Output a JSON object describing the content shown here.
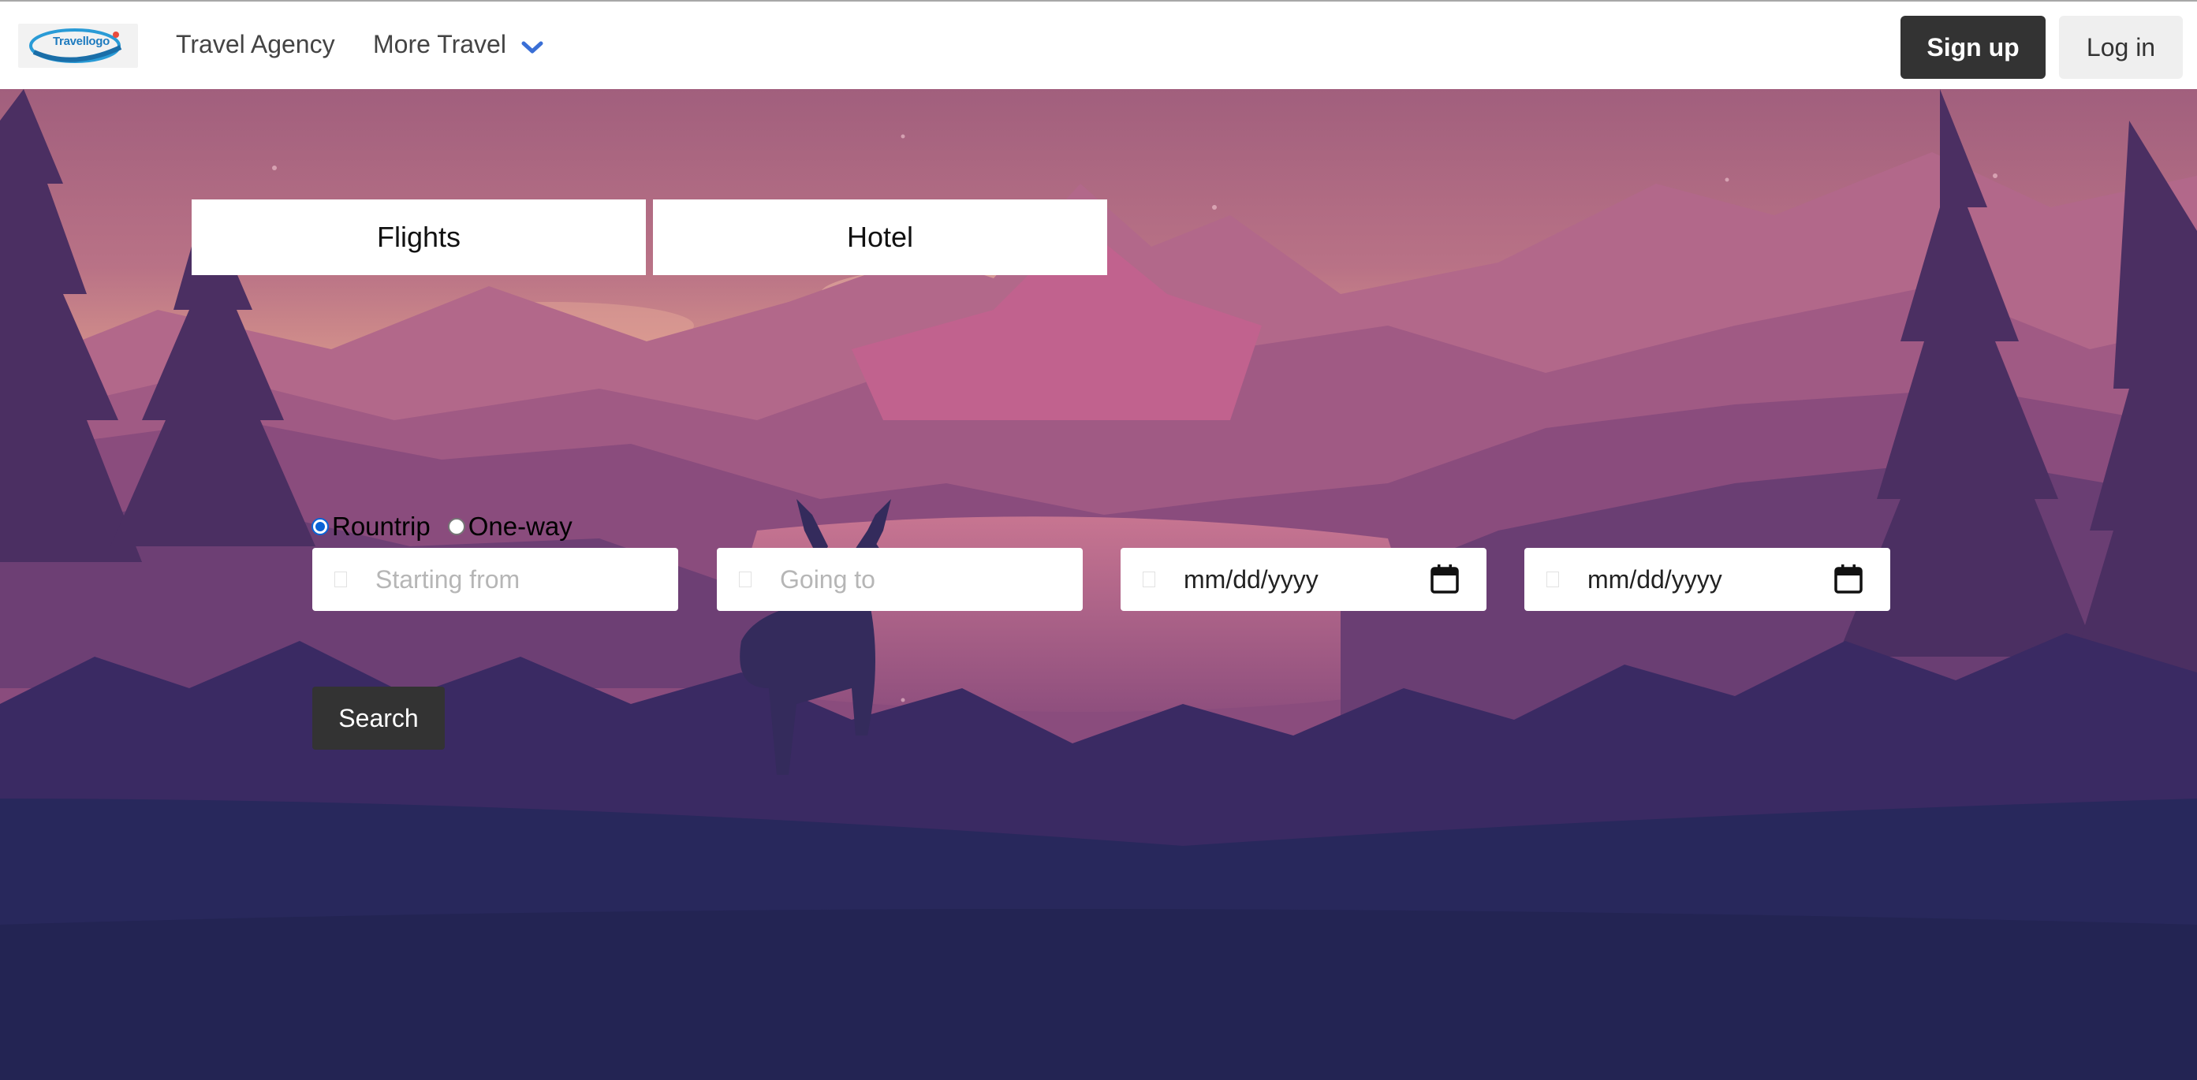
{
  "navbar": {
    "logo_text": "Travellogo",
    "links": [
      {
        "label": "Travel Agency"
      },
      {
        "label": "More Travel"
      }
    ],
    "signup_label": "Sign up",
    "login_label": "Log in"
  },
  "tabs": [
    {
      "label": "Flights"
    },
    {
      "label": "Hotel"
    }
  ],
  "trip_type": {
    "options": [
      {
        "label": "Rountrip",
        "checked": true
      },
      {
        "label": "One-way",
        "checked": false
      }
    ]
  },
  "fields": {
    "origin": {
      "placeholder": "Starting from",
      "value": ""
    },
    "destination": {
      "placeholder": "Going to",
      "value": ""
    },
    "depart_date": {
      "value": "mm/dd/yyyy"
    },
    "return_date": {
      "value": "mm/dd/yyyy"
    }
  },
  "search_label": "Search",
  "colors": {
    "button_dark": "#333333",
    "radio_accent": "#0a63d6",
    "sky_top": "#a76580",
    "sky_glow": "#e8a690",
    "ground": "#26275a"
  },
  "icons": {
    "dropdown": "chevron-down-icon",
    "calendar": "calendar-icon",
    "field": "input-icon"
  }
}
